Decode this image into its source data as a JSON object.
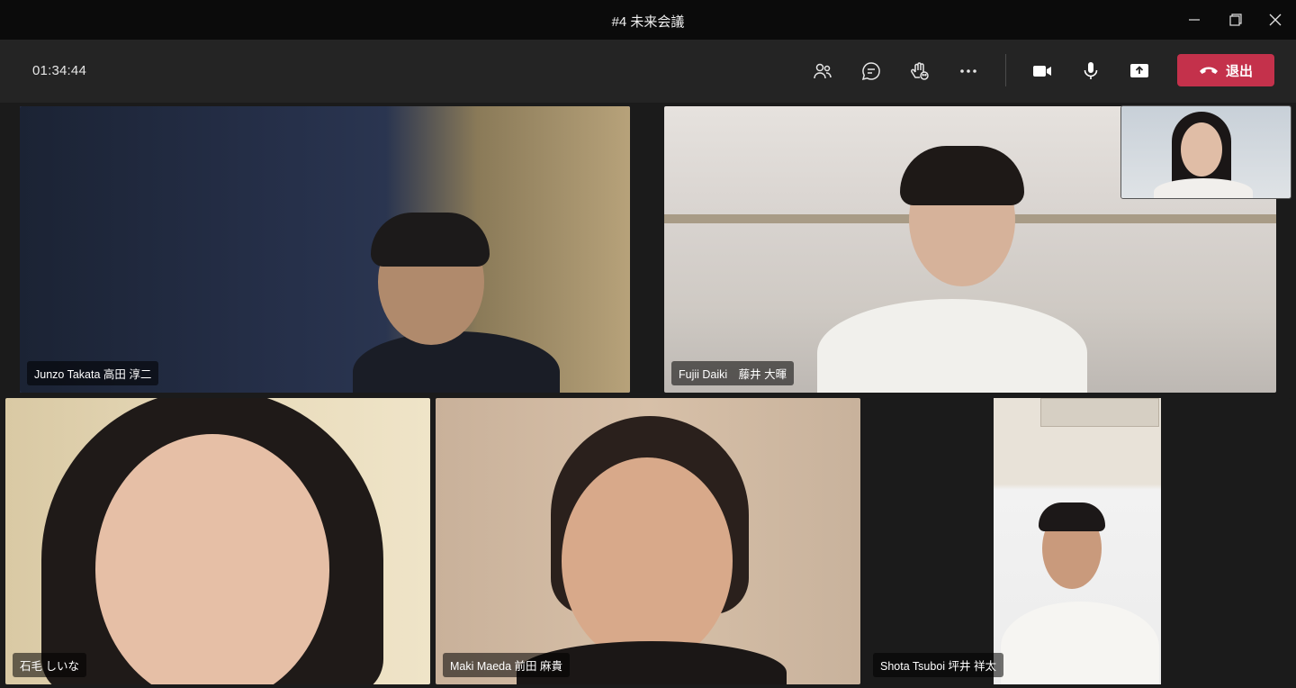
{
  "window": {
    "title": "#4 未来会議"
  },
  "toolbar": {
    "elapsed": "01:34:44",
    "leave_label": "退出",
    "buttons": [
      "people-icon",
      "chat-icon",
      "raise-hand-icon",
      "more-icon",
      "camera-icon",
      "mic-icon",
      "share-screen-icon"
    ]
  },
  "participants": [
    {
      "name": "Junzo Takata 高田 淳二",
      "speaking": true
    },
    {
      "name": "Fujii Daiki　藤井 大暉",
      "speaking": false
    },
    {
      "name": "石毛 しいな",
      "speaking": false
    },
    {
      "name": "Maki Maeda 前田 麻貴",
      "speaking": false
    },
    {
      "name": "Shota Tsuboi 坪井 祥太",
      "speaking": false
    }
  ],
  "colors": {
    "accent": "#7b83eb",
    "leave": "#c4314b",
    "titlebar": "#0b0b0b",
    "toolbar": "#242424"
  }
}
